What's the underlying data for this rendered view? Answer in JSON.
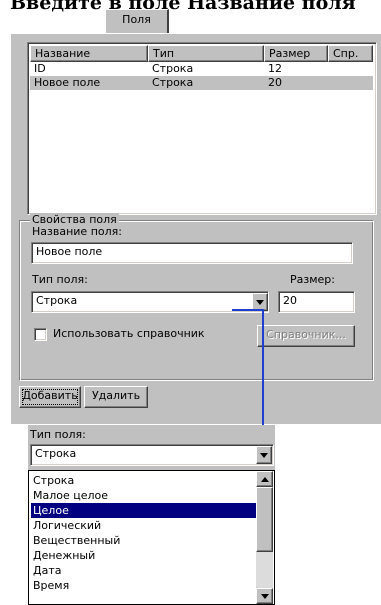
{
  "heading": "Введите в поле Название поля",
  "tab": "Поля",
  "listview": {
    "columns": [
      "Название",
      "Тип",
      "Размер",
      "Спр."
    ],
    "rows": [
      {
        "name": "ID",
        "type": "Строка",
        "size": "12",
        "ref": ""
      },
      {
        "name": "Новое поле",
        "type": "Строка",
        "size": "20",
        "ref": ""
      }
    ],
    "selected_row": 1
  },
  "props": {
    "group_title": "Свойства поля",
    "name_label": "Название поля:",
    "name_value": "Новое поле",
    "type_label": "Тип поля:",
    "type_value": "Строка",
    "size_label": "Размер:",
    "size_value": "20",
    "use_ref_label": "Использовать справочник",
    "use_ref_checked": false,
    "ref_button": "Справочник..."
  },
  "buttons": {
    "add": "Добавить",
    "delete": "Удалить"
  },
  "accent_color": "#1f3fcf",
  "popup": {
    "type_label": "Тип поля:",
    "type_value": "Строка",
    "options": [
      "Строка",
      "Малое целое",
      "Целое",
      "Логический",
      "Вещественный",
      "Денежный",
      "Дата",
      "Время"
    ],
    "selected_option": "Целое",
    "selection_color": "#000080"
  }
}
